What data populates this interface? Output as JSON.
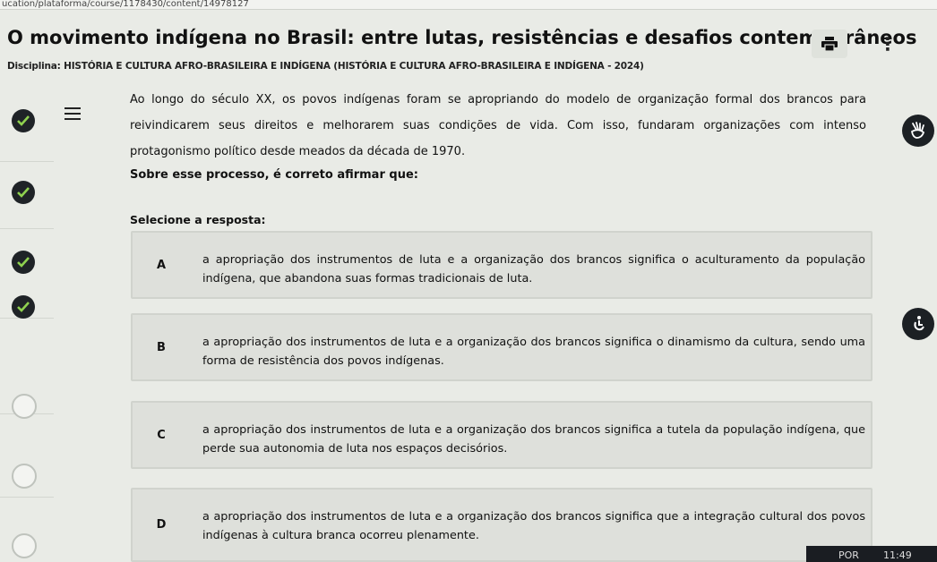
{
  "browser": {
    "url": "ucation/plataforma/course/1178430/content/14978127"
  },
  "header": {
    "title": "O movimento indígena no Brasil: entre lutas, resistências e desafios contemporâneos",
    "subtitle": "Disciplina: HISTÓRIA E CULTURA AFRO-BRASILEIRA E INDÍGENA (HISTÓRIA E CULTURA AFRO-BRASILEIRA E INDÍGENA - 2024)",
    "print_icon": "printer-icon",
    "more_icon": "more-vertical-icon",
    "more_glyph": "⋮"
  },
  "progress": {
    "steps": [
      {
        "status": "done",
        "icon": "check-icon"
      },
      {
        "status": "done",
        "icon": "check-icon"
      },
      {
        "status": "done",
        "icon": "check-icon"
      },
      {
        "status": "done",
        "icon": "check-icon"
      },
      {
        "status": "todo",
        "icon": "empty-circle-icon"
      },
      {
        "status": "todo",
        "icon": "empty-circle-icon"
      },
      {
        "status": "todo",
        "icon": "empty-circle-icon"
      }
    ]
  },
  "question": {
    "statement": "Ao longo do século XX, os povos indígenas foram se apropriando do modelo de organização formal dos brancos para reivindicarem seus direitos e melhorarem suas condições de vida. Com isso, fundaram organizações com intenso protagonismo político desde meados da década de 1970.",
    "prompt": "Sobre esse processo, é correto afirmar que:",
    "select_label": "Selecione a resposta:",
    "options": [
      {
        "letter": "A",
        "text": "a apropriação dos instrumentos de luta e a organização dos brancos significa o aculturamento da população indígena, que abandona suas formas tradicionais de luta."
      },
      {
        "letter": "B",
        "text": "a apropriação dos instrumentos de luta e a organização dos brancos significa o dinamismo da cultura, sendo uma forma de resistência dos povos indígenas."
      },
      {
        "letter": "C",
        "text": "a apropriação dos instrumentos de luta e a organização dos brancos significa a tutela da população indígena, que perde sua autonomia de luta nos espaços decisórios."
      },
      {
        "letter": "D",
        "text": "a apropriação dos instrumentos de luta e a organização dos brancos significa que a integração cultural dos povos indígenas à cultura branca ocorreu plenamente."
      }
    ]
  },
  "side_tools": {
    "accessibility_icon": "sign-language-icon",
    "help_icon": "accessibility-help-icon"
  },
  "taskbar": {
    "lang": "POR",
    "time": "11:49"
  },
  "colors": {
    "background": "#e9ebe6",
    "option_bg": "#dee0db",
    "done_step": "#1f2327"
  }
}
